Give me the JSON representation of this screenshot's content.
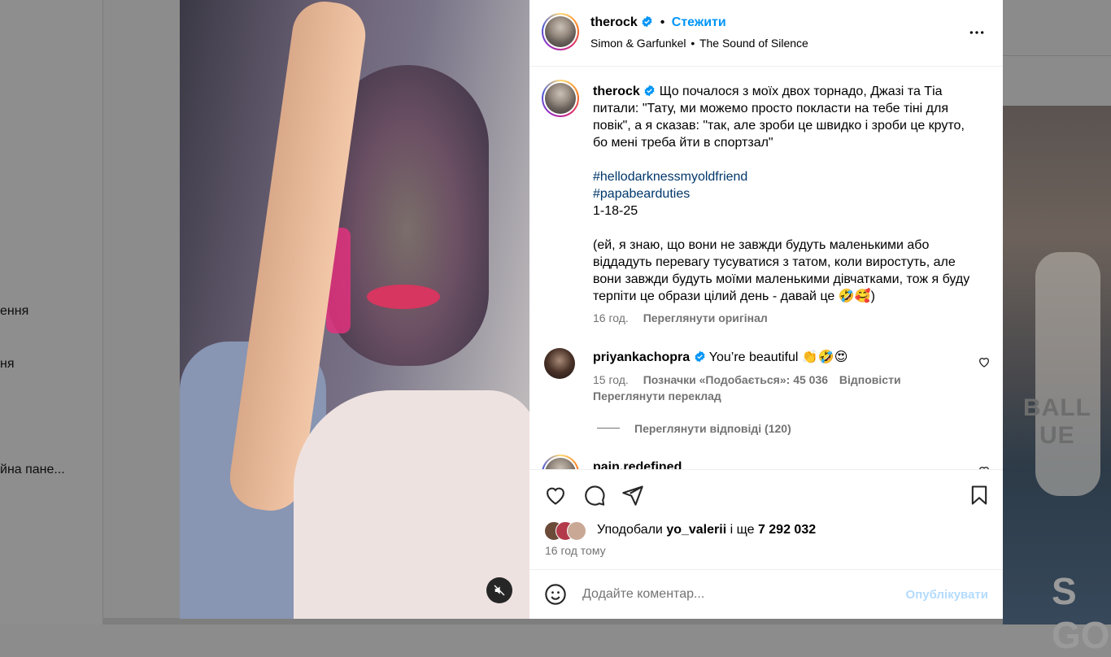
{
  "background": {
    "left_items": [
      "ення",
      "ня",
      "йна пане..."
    ],
    "right_thumb_text": [
      "BALL",
      "UE",
      "S GO"
    ]
  },
  "post": {
    "username": "therock",
    "follow_label": "Стежити",
    "separator": "•",
    "audio_artist": "Simon & Garfunkel",
    "audio_title": "The Sound of Silence",
    "caption": {
      "username": "therock",
      "text_1": "Що почалося з моїх двох торнадо, Джазі та Тіа питали: \"Тату, ми можемо просто покласти на тебе тіні для повік\", а я сказав: \"так, але зроби це швидко і зроби це круто, бо мені треба йти в спортзал\"",
      "hashtag_1": "#hellodarknessmyoldfriend",
      "hashtag_2": "#papabearduties",
      "date": "1-18-25",
      "text_2": "(ей, я знаю, що вони не завжди будуть маленькими або віддадуть перевагу тусуватися з татом, коли виростуть, але вони завжди будуть моїми маленькими дівчатками, тож я буду терпіти це образи цілий день - давай це 🤣🥰)",
      "time": "16 год.",
      "see_original": "Переглянути оригінал"
    },
    "comments": [
      {
        "username": "priyankachopra",
        "text": "You’re beautiful 👏🤣😍",
        "time": "15 год.",
        "likes": "Позначки «Подобається»: 45 036",
        "reply": "Відповісти",
        "see_translation": "Переглянути переклад",
        "view_replies": "Переглянути відповіді (120)"
      },
      {
        "username": "pain.redefined"
      }
    ],
    "liked_by_prefix": "Уподобали",
    "liked_by_user": "yo_valerii",
    "liked_by_and": "і ще",
    "liked_by_count": "7 292 032",
    "posted_time": "16 год тому",
    "comment_placeholder": "Додайте коментар...",
    "post_label": "Опублікувати"
  },
  "colors": {
    "accent": "#0095f6",
    "hashtag": "#00376b",
    "secondary_text": "#737373",
    "post_disabled": "#b3dbff"
  }
}
